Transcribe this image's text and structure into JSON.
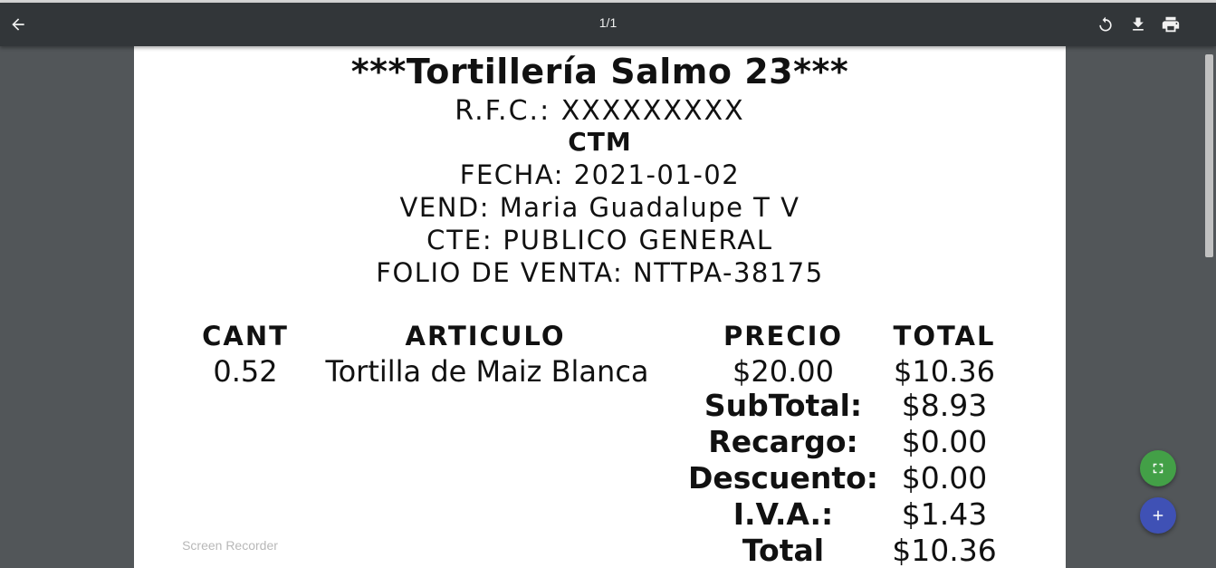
{
  "toolbar": {
    "back_icon": "arrow-left-icon",
    "page_counter": "1/1",
    "rotate_icon": "rotate-icon",
    "download_icon": "download-icon",
    "print_icon": "print-icon"
  },
  "receipt": {
    "title": "***Tortillería Salmo 23***",
    "rfc": "R.F.C.: XXXXXXXXX",
    "ctm": "CTM",
    "fecha": "FECHA: 2021-01-02",
    "vend": "VEND: Maria Guadalupe T V",
    "cte": "CTE: PUBLICO GENERAL",
    "folio": "FOLIO DE VENTA: NTTPA-38175",
    "columns": [
      "CANT",
      "ARTICULO",
      "PRECIO",
      "TOTAL"
    ],
    "items": [
      {
        "cant": "0.52",
        "articulo": "Tortilla de Maiz Blanca",
        "precio": "$20.00",
        "total": "$10.36"
      }
    ],
    "totals": [
      {
        "label": "SubTotal:",
        "value": "$8.93"
      },
      {
        "label": "Recargo:",
        "value": "$0.00"
      },
      {
        "label": "Descuento:",
        "value": "$0.00"
      },
      {
        "label": "I.V.A.:",
        "value": "$1.43"
      },
      {
        "label": "Total",
        "value": "$10.36"
      }
    ]
  },
  "overlay": {
    "recorder_label": "Screen Recorder",
    "fullscreen_icon": "fullscreen-icon",
    "add_icon": "plus-icon"
  },
  "colors": {
    "toolbar_bg": "#323639",
    "viewer_bg": "#525659",
    "fab_green": "#43a047",
    "fab_blue": "#3f51b5"
  }
}
